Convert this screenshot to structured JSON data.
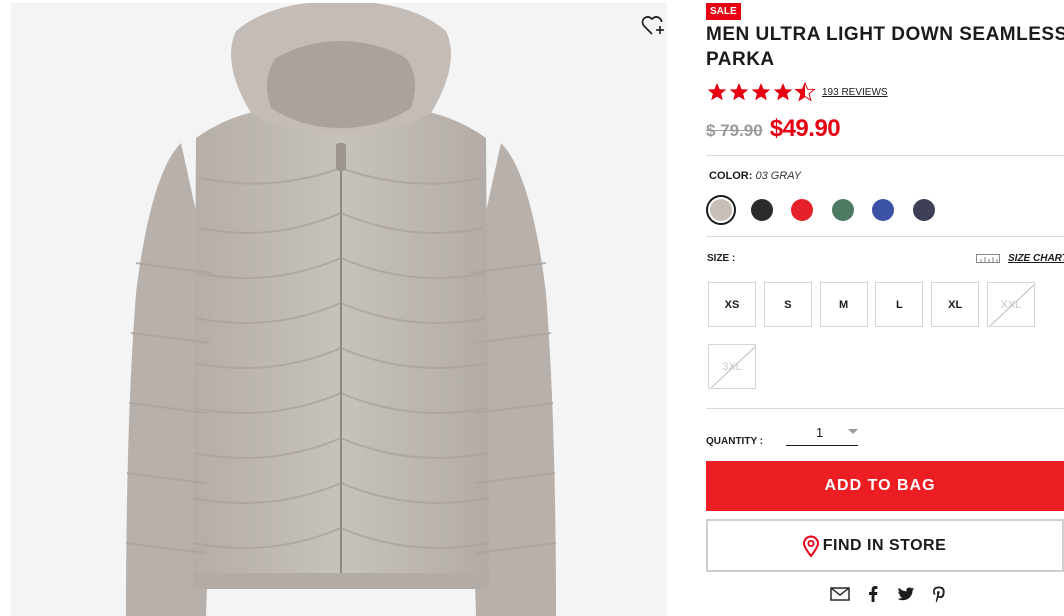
{
  "product": {
    "badge": "SALE",
    "title": "MEN ULTRA LIGHT DOWN SEAMLESS PARKA",
    "rating": 4.6,
    "reviews_label": "193 REVIEWS",
    "original_price": "$ 79.90",
    "sale_price": "$49.90"
  },
  "color": {
    "label": "COLOR:",
    "selected_name": "03 GRAY",
    "options": [
      {
        "name": "03 GRAY",
        "hex": "#c7bfb7",
        "selected": true
      },
      {
        "name": "black",
        "hex": "#2c2a29",
        "selected": false
      },
      {
        "name": "red",
        "hex": "#e5202a",
        "selected": false
      },
      {
        "name": "green",
        "hex": "#4d7a62",
        "selected": false
      },
      {
        "name": "blue",
        "hex": "#3c52a5",
        "selected": false
      },
      {
        "name": "navy",
        "hex": "#3d3f55",
        "selected": false
      }
    ]
  },
  "size": {
    "label": "SIZE :",
    "chart_label": "SIZE CHART",
    "options": [
      {
        "label": "XS",
        "available": true
      },
      {
        "label": "S",
        "available": true
      },
      {
        "label": "M",
        "available": true
      },
      {
        "label": "L",
        "available": true
      },
      {
        "label": "XL",
        "available": true
      },
      {
        "label": "XXL",
        "available": false
      },
      {
        "label": "3XL",
        "available": false
      }
    ]
  },
  "quantity": {
    "label": "QUANTITY :",
    "value": "1"
  },
  "actions": {
    "add_to_bag": "ADD TO BAG",
    "find_in_store": "FIND IN STORE"
  },
  "share": [
    "mail-icon",
    "facebook-icon",
    "twitter-icon",
    "pinterest-icon"
  ],
  "colors": {
    "accent": "#e60012",
    "old_price": "#9b9b9b",
    "jacket": "#bfb8b3"
  }
}
